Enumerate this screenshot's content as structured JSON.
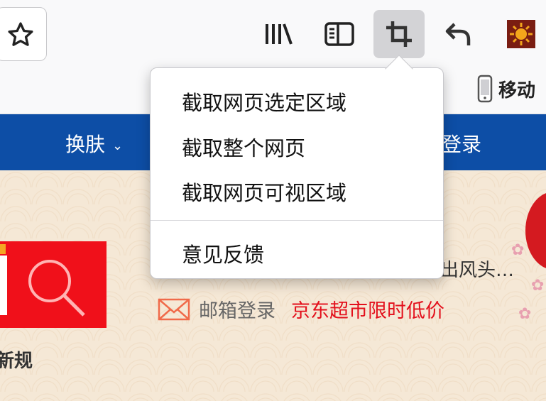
{
  "toolbar": {
    "icons": [
      "star-icon",
      "library-icon",
      "sidebar-icon",
      "crop-screenshot-icon",
      "back-arrow-icon",
      "extension-icon"
    ],
    "active": "crop-screenshot-icon"
  },
  "bookmarks": {
    "item_label": "移动",
    "item_icon": "phone-icon"
  },
  "page": {
    "nav": {
      "skin_label": "换肤",
      "login_label": "登录"
    },
    "new_rule_text": "新规",
    "headline_text": "出风头…",
    "mail_label": "邮箱登录",
    "promo_text": "京东超市限时低价",
    "colors": {
      "nav_blue": "#0d4ea6",
      "search_red": "#f0101a",
      "promo_red": "#e3101c"
    }
  },
  "screenshot_menu": {
    "items": [
      {
        "label": "截取网页选定区域"
      },
      {
        "label": "截取整个网页"
      },
      {
        "label": "截取网页可视区域"
      }
    ],
    "feedback_label": "意见反馈"
  }
}
